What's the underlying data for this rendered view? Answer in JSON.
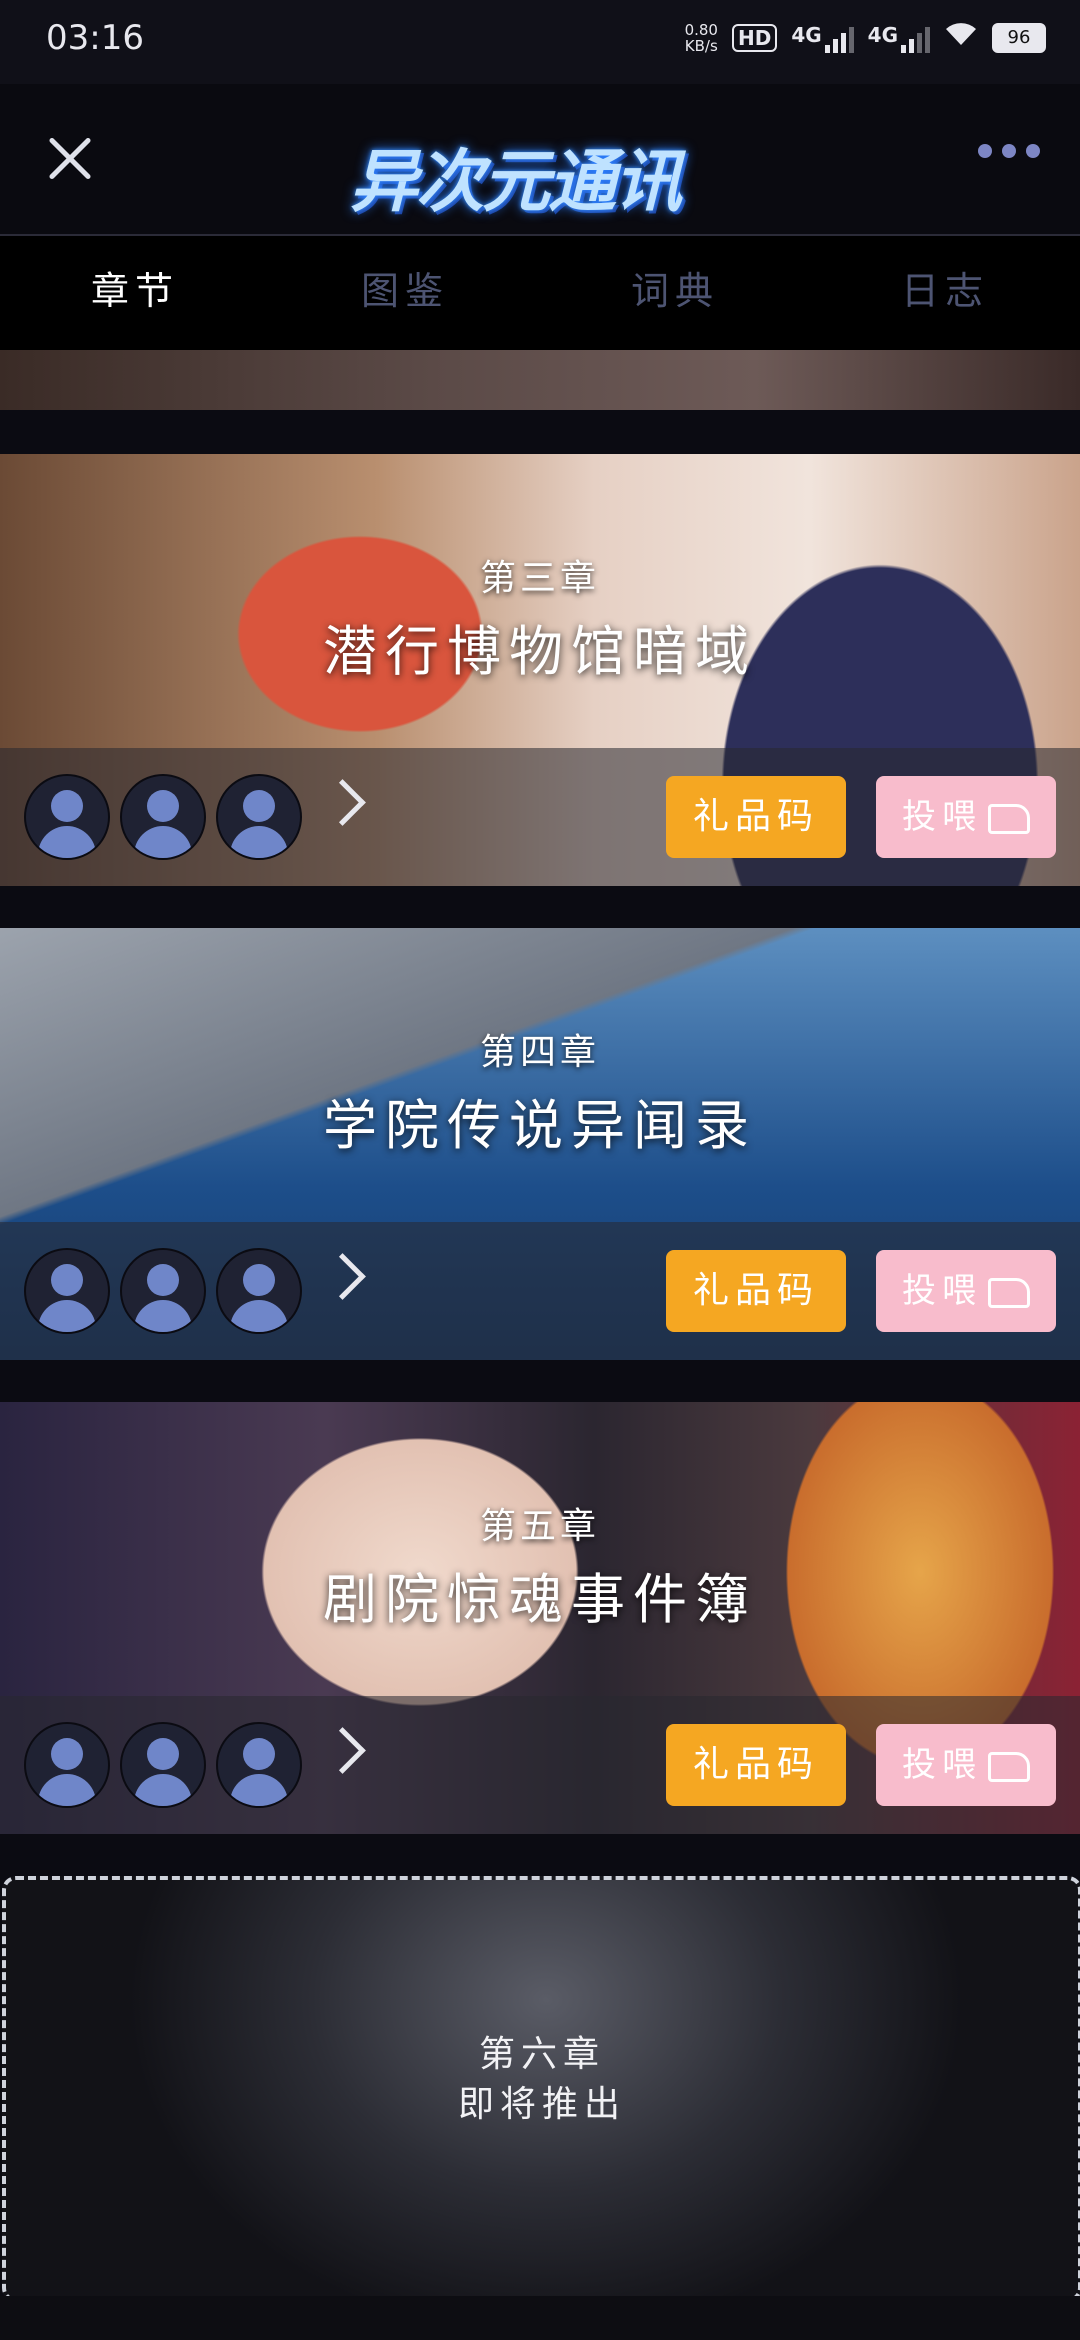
{
  "status_bar": {
    "time": "03:16",
    "net_speed_value": "0.80",
    "net_speed_unit": "KB/s",
    "hd_label": "HD",
    "signal1_label": "4G",
    "signal2_label": "4G",
    "battery": "96"
  },
  "header": {
    "logo_text": "异次元通讯"
  },
  "tabs": [
    {
      "label": "章节",
      "active": true
    },
    {
      "label": "图鉴",
      "active": false
    },
    {
      "label": "词典",
      "active": false
    },
    {
      "label": "日志",
      "active": false
    }
  ],
  "buttons": {
    "gift_code": "礼品码",
    "feed": "投喂"
  },
  "chapters": [
    {
      "number": "第三章",
      "title": "潜行博物馆暗域"
    },
    {
      "number": "第四章",
      "title": "学院传说异闻录"
    },
    {
      "number": "第五章",
      "title": "剧院惊魂事件簿"
    }
  ],
  "upcoming": {
    "number": "第六章",
    "status": "即将推出"
  },
  "colors": {
    "gift_button": "#f5a722",
    "feed_button": "#f8bccc",
    "tab_active": "#ffffff",
    "tab_inactive": "#4d5472"
  }
}
